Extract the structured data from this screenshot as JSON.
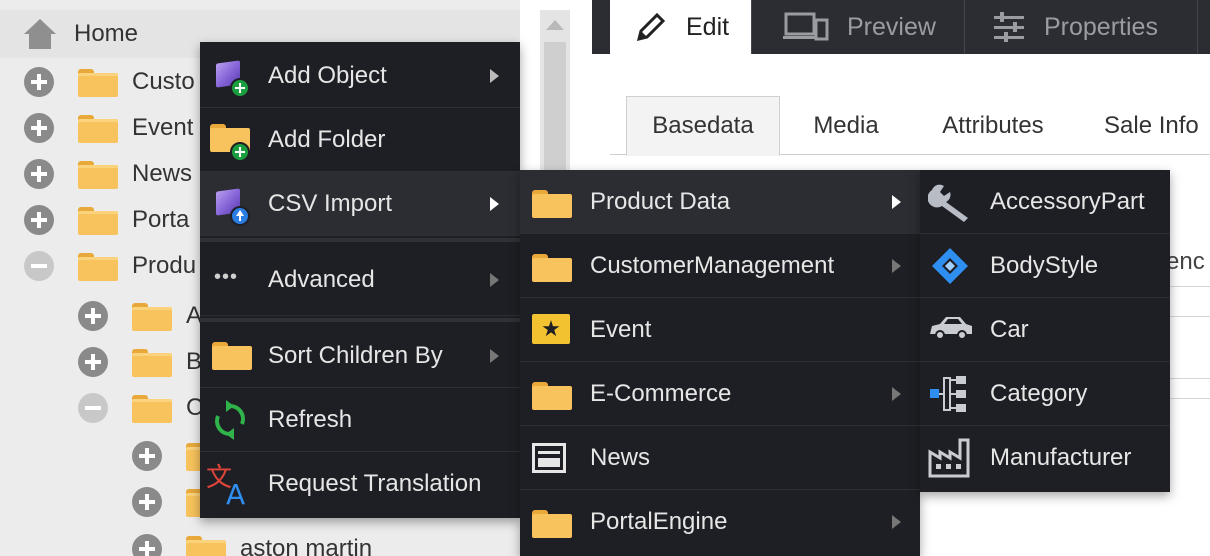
{
  "tree": {
    "home_label": "Home",
    "items": [
      {
        "label": "Custo",
        "expander": "plus"
      },
      {
        "label": "Event",
        "expander": "plus"
      },
      {
        "label": "News",
        "expander": "plus"
      },
      {
        "label": "Porta",
        "expander": "plus"
      },
      {
        "label": "Produ",
        "expander": "minus"
      }
    ],
    "sub_items": [
      {
        "label": "A",
        "expander": "plus"
      },
      {
        "label": "B",
        "expander": "plus"
      },
      {
        "label": "C",
        "expander": "minus"
      }
    ],
    "subsub_items": [
      {
        "label": "",
        "expander": "plus"
      },
      {
        "label": "",
        "expander": "plus"
      },
      {
        "label": "aston martin",
        "expander": "plus"
      }
    ]
  },
  "top_tabs": [
    {
      "label": "Edit",
      "icon": "pencil-icon",
      "active": true
    },
    {
      "label": "Preview",
      "icon": "devices-icon",
      "active": false
    },
    {
      "label": "Properties",
      "icon": "sliders-icon",
      "active": false
    }
  ],
  "sub_tabs": [
    "Basedata",
    "Media",
    "Attributes",
    "Sale Info"
  ],
  "clipped_text": "enc",
  "context_menu": {
    "items": [
      {
        "label": "Add Object",
        "icon": "add-object-icon",
        "has_submenu": true
      },
      {
        "label": "Add Folder",
        "icon": "add-folder-icon",
        "has_submenu": false
      },
      {
        "label": "CSV Import",
        "icon": "csv-import-icon",
        "has_submenu": true,
        "highlighted": true
      },
      {
        "label": "Advanced",
        "icon": "more-dots-icon",
        "has_submenu": true
      },
      {
        "label": "Sort Children By",
        "icon": "folder-icon",
        "has_submenu": true
      },
      {
        "label": "Refresh",
        "icon": "refresh-icon",
        "has_submenu": false
      },
      {
        "label": "Request Translation",
        "icon": "translate-icon",
        "has_submenu": false
      }
    ]
  },
  "csv_submenu": {
    "items": [
      {
        "label": "Product Data",
        "icon": "folder-icon",
        "has_submenu": true,
        "highlighted": true
      },
      {
        "label": "CustomerManagement",
        "icon": "folder-icon",
        "has_submenu": true
      },
      {
        "label": "Event",
        "icon": "star-icon",
        "has_submenu": false
      },
      {
        "label": "E-Commerce",
        "icon": "folder-icon",
        "has_submenu": true
      },
      {
        "label": "News",
        "icon": "news-icon",
        "has_submenu": false
      },
      {
        "label": "PortalEngine",
        "icon": "folder-icon",
        "has_submenu": true
      }
    ]
  },
  "product_submenu": {
    "items": [
      {
        "label": "AccessoryPart",
        "icon": "wrench-icon"
      },
      {
        "label": "BodyStyle",
        "icon": "bodystyle-icon"
      },
      {
        "label": "Car",
        "icon": "car-icon"
      },
      {
        "label": "Category",
        "icon": "category-icon"
      },
      {
        "label": "Manufacturer",
        "icon": "factory-icon"
      }
    ]
  },
  "colors": {
    "menu_bg": "#1e1f24",
    "menu_highlight": "#2b2d33",
    "folder": "#f8c35c",
    "badge_green": "#1b9e3e",
    "badge_blue": "#2a7de1",
    "bodystyle_blue": "#2f8ff0"
  }
}
